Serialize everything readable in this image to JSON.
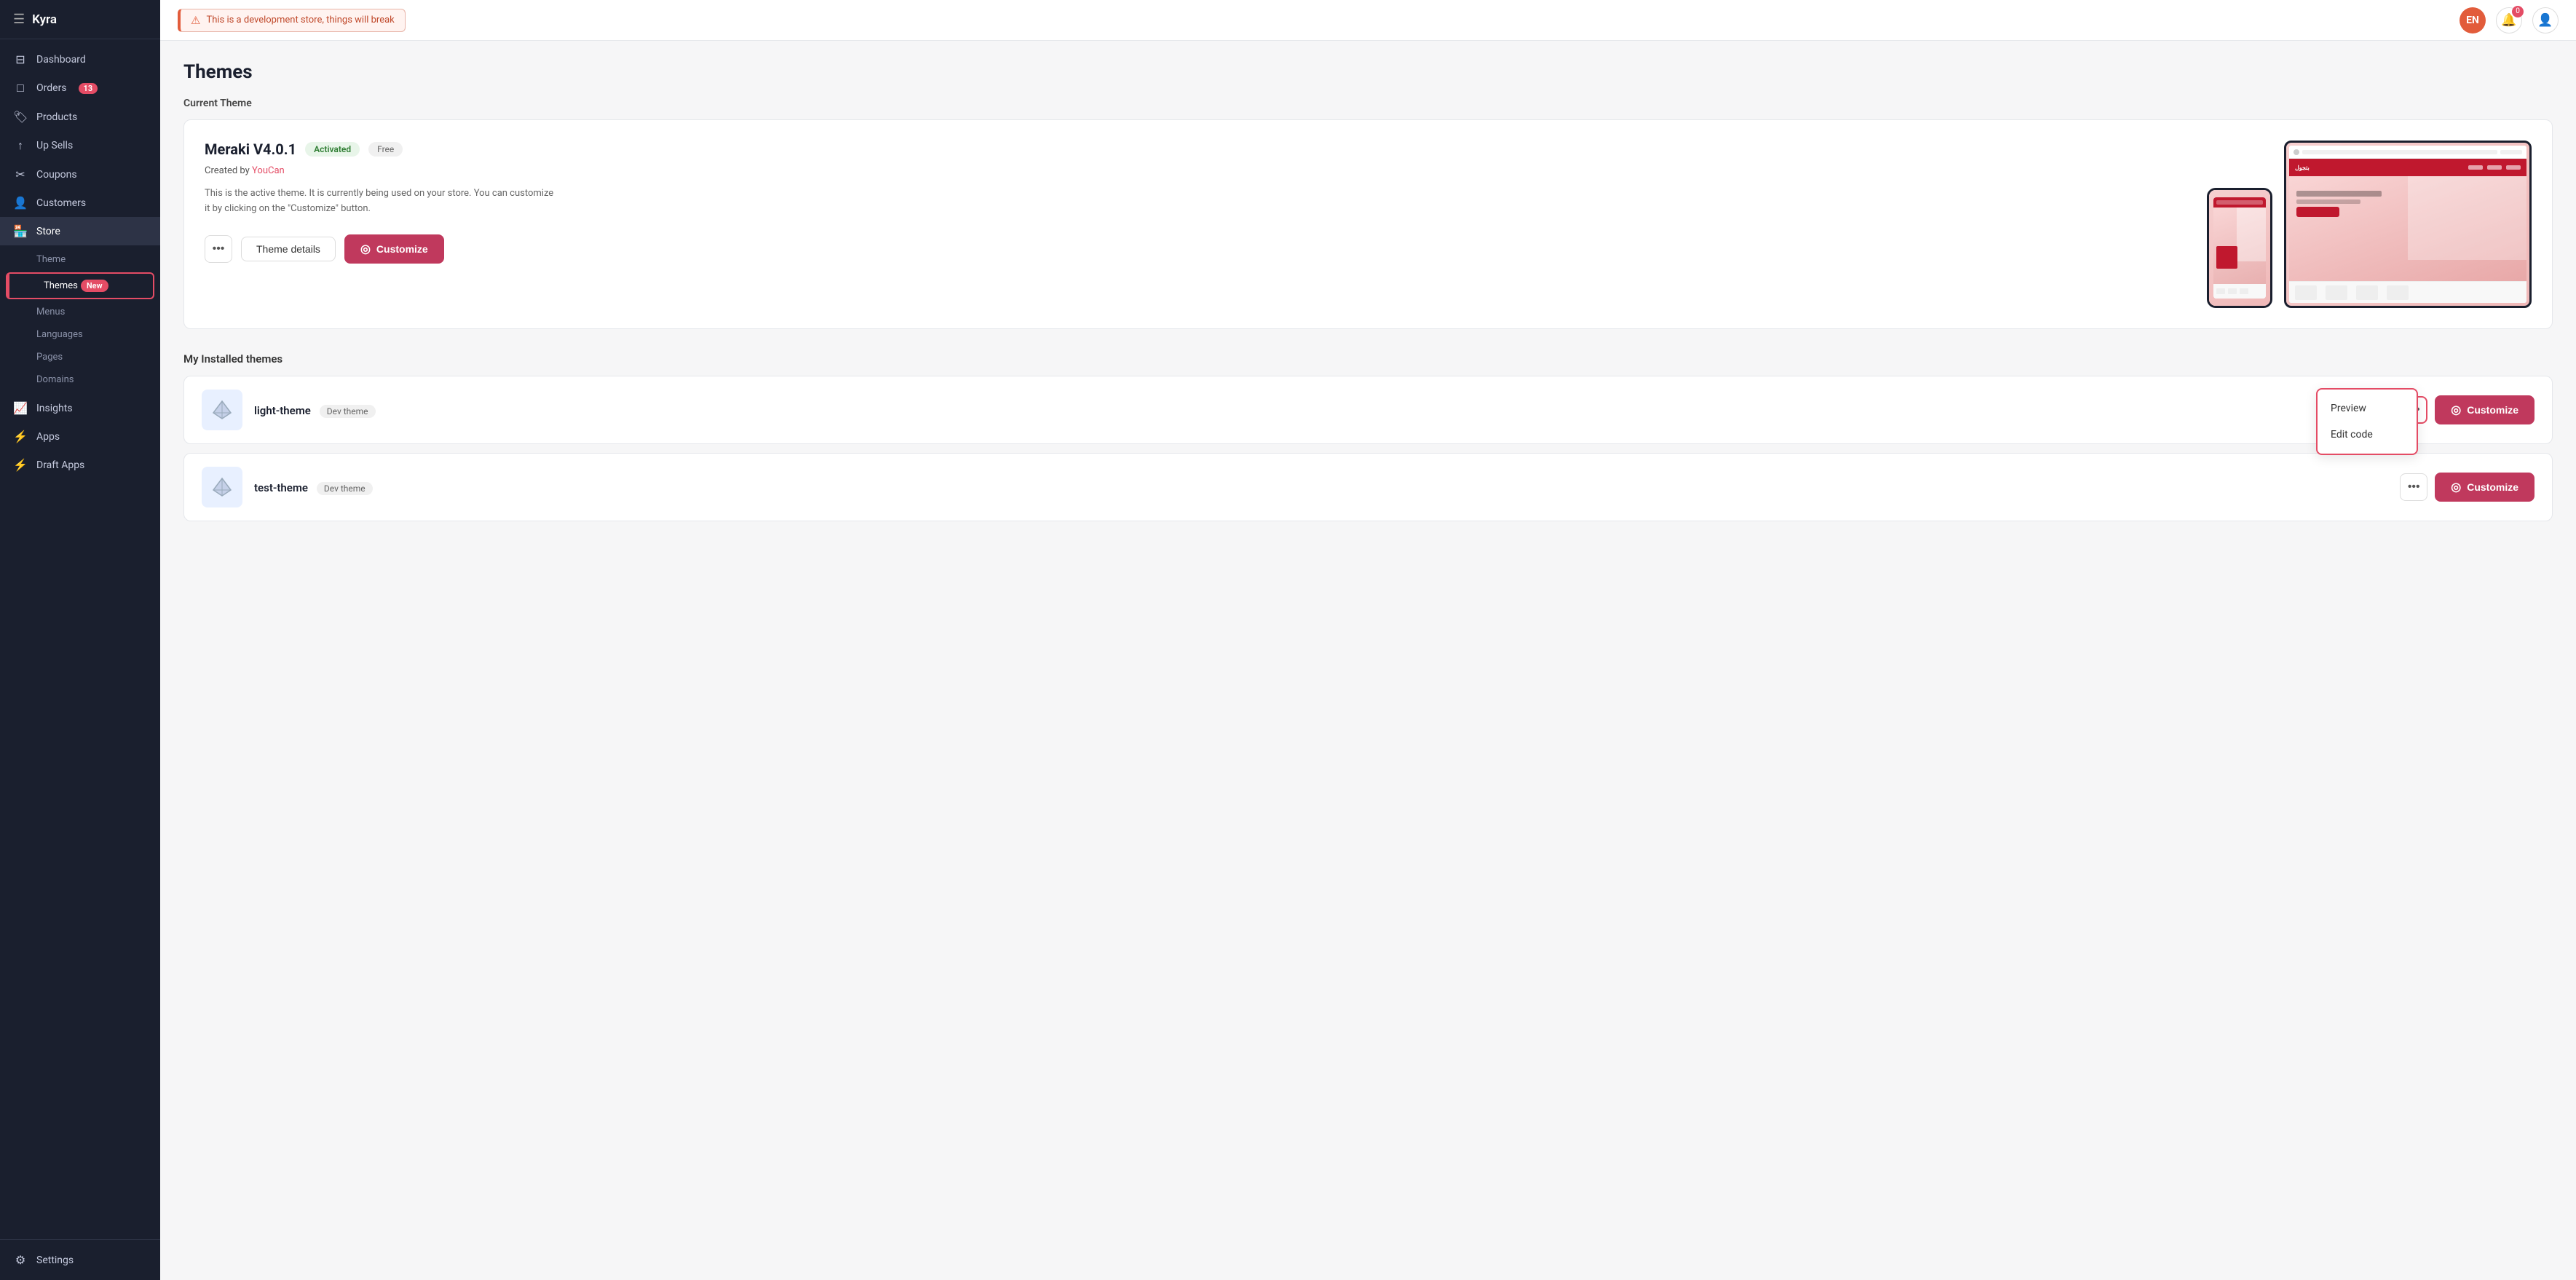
{
  "store": {
    "name": "Kyra"
  },
  "topbar": {
    "dev_banner": "This is a development store, things will break",
    "avatar_initials": "EN",
    "notification_count": "0"
  },
  "sidebar": {
    "items": [
      {
        "id": "dashboard",
        "label": "Dashboard",
        "icon": "⊞"
      },
      {
        "id": "orders",
        "label": "Orders",
        "icon": "📦",
        "badge": "13"
      },
      {
        "id": "products",
        "label": "Products",
        "icon": "🏷"
      },
      {
        "id": "upsells",
        "label": "Up Sells",
        "icon": "↑"
      },
      {
        "id": "coupons",
        "label": "Coupons",
        "icon": "🎟"
      },
      {
        "id": "customers",
        "label": "Customers",
        "icon": "👤"
      },
      {
        "id": "store",
        "label": "Store",
        "icon": "🏪"
      }
    ],
    "store_sub": [
      {
        "id": "theme",
        "label": "Theme"
      },
      {
        "id": "themes",
        "label": "Themes",
        "badge": "New"
      },
      {
        "id": "menus",
        "label": "Menus"
      },
      {
        "id": "languages",
        "label": "Languages"
      },
      {
        "id": "pages",
        "label": "Pages"
      },
      {
        "id": "domains",
        "label": "Domains"
      }
    ],
    "bottom_items": [
      {
        "id": "insights",
        "label": "Insights",
        "icon": "📈"
      },
      {
        "id": "apps",
        "label": "Apps",
        "icon": "⚡"
      },
      {
        "id": "draft_apps",
        "label": "Draft Apps",
        "icon": "⚡"
      },
      {
        "id": "settings",
        "label": "Settings",
        "icon": "⚙"
      }
    ]
  },
  "page": {
    "title": "Themes",
    "current_theme_label": "Current Theme"
  },
  "current_theme": {
    "name": "Meraki V4.0.1",
    "status": "Activated",
    "price": "Free",
    "creator_prefix": "Created by",
    "creator_name": "YouCan",
    "description": "This is the active theme. It is currently being used on your store. You can customize it by clicking on the \"Customize\" button.",
    "btn_more": "···",
    "btn_details": "Theme details",
    "btn_customize": "Customize"
  },
  "installed_themes": {
    "label": "My Installed themes",
    "items": [
      {
        "id": "light-theme",
        "name": "light-theme",
        "tag": "Dev theme"
      },
      {
        "id": "test-theme",
        "name": "test-theme",
        "tag": "Dev theme"
      }
    ]
  },
  "dropdown": {
    "items": [
      {
        "id": "preview",
        "label": "Preview"
      },
      {
        "id": "edit-code",
        "label": "Edit code"
      }
    ]
  },
  "icons": {
    "hamburger": "☰",
    "dashboard": "⊟",
    "box": "📦",
    "tag": "🏷",
    "arrow_up": "↑",
    "coupon": "✂",
    "user": "👤",
    "store": "🏪",
    "chart": "📈",
    "bolt": "⚡",
    "gear": "⚙",
    "more": "•••",
    "customize_circle": "◎",
    "warn": "⚠",
    "diamond": "◆"
  }
}
